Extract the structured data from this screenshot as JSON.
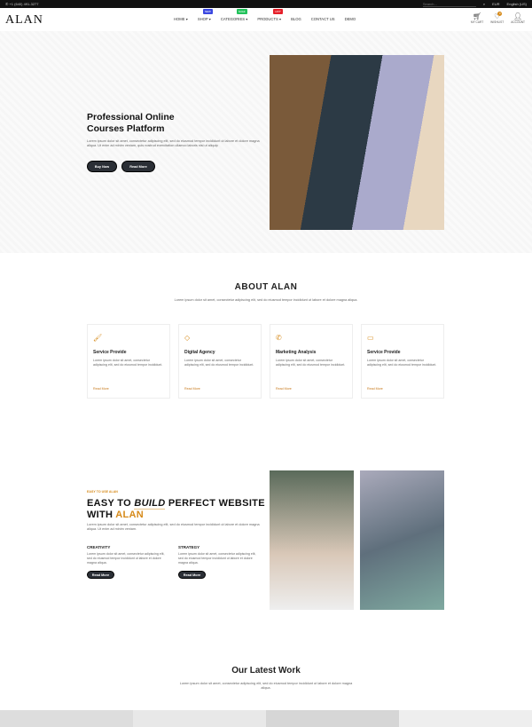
{
  "topbar": {
    "phone": "+1 (640) 491-3277",
    "search_placeholder": "Search...",
    "currency": "EUR",
    "language": "English (US)"
  },
  "header": {
    "logo": "ALAN",
    "nav": [
      {
        "label": "HOME"
      },
      {
        "label": "SHOP",
        "badge": "NEW",
        "badge_color": "#3b48e0"
      },
      {
        "label": "CATEGORIES",
        "badge": "SALE",
        "badge_color": "#21c25a"
      },
      {
        "label": "PRODUCTS",
        "badge": "HOT",
        "badge_color": "#e5202a"
      },
      {
        "label": "BLOG"
      },
      {
        "label": "CONTACT US"
      },
      {
        "label": "DEMO"
      }
    ],
    "cart": "MY CART",
    "wishlist": "WISHLIST",
    "wishlist_count": "0",
    "account": "ACCOUNT"
  },
  "hero": {
    "title_line1": "Professional Online",
    "title_line2": "Courses Platform",
    "text": "Lorem ipsum dolor sit amet, consectetur adipiscing elit, sed do eiusmod tempor incididunt ut labore et dolore magna aliqua. Ut enim ad minim veniam, quis nostrud exercitation ullamco laboris nisi ut aliquip",
    "buy_now": "Buy Now",
    "read_more": "Read More"
  },
  "about": {
    "title": "ABOUT ALAN",
    "text": "Lorem ipsum dolor sit amet, consectetur adipiscing elit, sed do eiusmod tempor incididunt ut labore et dolore magna aliqua.",
    "cards": [
      {
        "icon": "brush-icon",
        "title": "Service Provide",
        "text": "Lorem ipsum dolor sit amet, consectetur adipiscing elit, sed do eiusmod tempor incididunt.",
        "link": "Read More"
      },
      {
        "icon": "diamond-icon",
        "title": "Digital Agency",
        "text": "Lorem ipsum dolor sit amet, consectetur adipiscing elit, sed do eiusmod tempor incididunt.",
        "link": "Read More"
      },
      {
        "icon": "phone-icon",
        "title": "Marketing Analysis",
        "text": "Lorem ipsum dolor sit amet, consectetur adipiscing elit, sed do eiusmod tempor incididunt.",
        "link": "Read More"
      },
      {
        "icon": "inbox-icon",
        "title": "Service Provide",
        "text": "Lorem ipsum dolor sit amet, consectetur adipiscing elit, sed do eiusmod tempor incididunt.",
        "link": "Read More"
      }
    ]
  },
  "build": {
    "eyebrow": "EASY TO USE ALAN",
    "t1": "EASY TO ",
    "t2": "BUILD",
    "t3": " PERFECT WEBSITE",
    "t4": "WITH ",
    "t5": "ALAN",
    "text": "Lorem ipsum dolor sit amet, consectetur adipiscing elit, sed do eiusmod tempor incididunt ut labore et dolore magna aliqua. Ut enim ad minim veniam.",
    "cols": [
      {
        "title": "CREATIVITY",
        "text": "Lorem ipsum dolor sit amet, consectetur adipiscing elit, sed do eiusmod tempor incididunt ut labore et dolore magna aliqua.",
        "button": "Read More"
      },
      {
        "title": "STRATEGY",
        "text": "Lorem ipsum dolor sit amet, consectetur adipiscing elit, sed do eiusmod tempor incididunt ut labore et dolore magna aliqua.",
        "button": "Read More"
      }
    ]
  },
  "work": {
    "title": "Our Latest Work",
    "text": "Lorem ipsum dolor sit amet, consectetur adipiscing elit, sed do eiusmod tempor incididunt ut labore et dolore magna aliqua."
  }
}
